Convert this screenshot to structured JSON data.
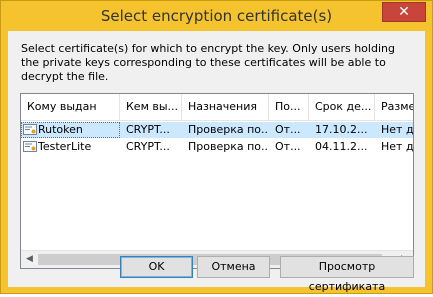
{
  "window": {
    "title": "Select encryption certificate(s)",
    "close_symbol": "✕"
  },
  "description": "Select certificate(s) for which to encrypt the key.  Only users holding the private keys corresponding to these certificates will be able to decrypt the file.",
  "columns": [
    "Кому выдан",
    "Кем вы...",
    "Назначения",
    "По...",
    "Срок де...",
    "Разме"
  ],
  "rows": [
    {
      "cells": [
        "Rutoken",
        "CRYPT...",
        "Проверка по...",
        "От...",
        "17.10.2...",
        "Нет д"
      ],
      "selected": true
    },
    {
      "cells": [
        "TesterLite",
        "CRYPT...",
        "Проверка по...",
        "От...",
        "04.11.2...",
        "Нет д"
      ],
      "selected": false
    }
  ],
  "scrollbar": {
    "left_arrow": "◀",
    "right_arrow": "▶"
  },
  "buttons": {
    "ok": "OK",
    "cancel": "Отмена",
    "view": "Просмотр сертификата"
  },
  "icons": {
    "row_icon": "certificate-icon",
    "close": "close-icon"
  }
}
